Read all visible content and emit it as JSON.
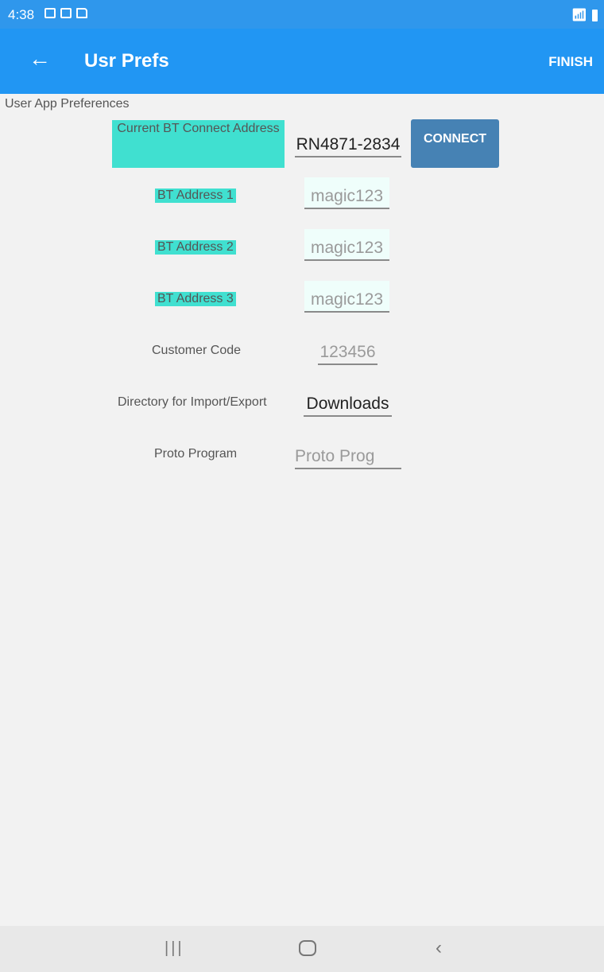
{
  "status_bar": {
    "time": "4:38",
    "notification_icons": [
      "image-icon",
      "mail-icon",
      "document-search-icon"
    ],
    "right_icons": [
      "wifi-icon",
      "battery-icon"
    ]
  },
  "app_bar": {
    "back_icon": "arrow-left-icon",
    "title": "Usr Prefs",
    "finish_label": "FINISH",
    "color": "#2196f3"
  },
  "page": {
    "section_title": "User App Preferences"
  },
  "preferences": {
    "current_bt_label": "Current BT Connect Address",
    "current_bt_value": "RN4871-2834",
    "connect_label": "CONNECT",
    "bt_address_1_label": "BT  Address 1",
    "bt_address_1_hint": "magic123",
    "bt_address_2_label": "BT  Address 2",
    "bt_address_2_hint": "magic123",
    "bt_address_3_label": "BT  Address 3",
    "bt_address_3_hint": "magic123",
    "customer_code_label": "Customer Code",
    "customer_code_hint": "123456",
    "directory_label": "Directory for Import/Export",
    "directory_value": "Downloads",
    "proto_program_label": "Proto Program",
    "proto_program_hint": "Proto Prog",
    "highlight_color": "#40e0d0",
    "button_color": "#4682b4"
  },
  "nav_bar": {
    "recent_icon": "recent-apps-icon",
    "home_icon": "home-icon",
    "back_icon": "back-icon"
  }
}
